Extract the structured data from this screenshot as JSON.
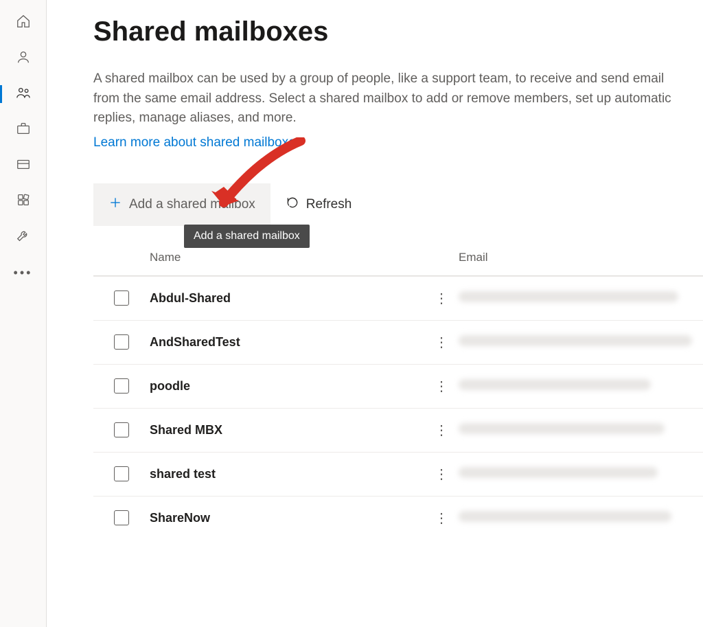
{
  "page": {
    "title": "Shared mailboxes",
    "description": "A shared mailbox can be used by a group of people, like a support team, to receive and send email from the same email address. Select a shared mailbox to add or remove members, set up automatic replies, manage aliases, and more.",
    "learn_link": "Learn more about shared mailboxes"
  },
  "toolbar": {
    "add_label": "Add a shared mailbox",
    "refresh_label": "Refresh",
    "tooltip": "Add a shared mailbox"
  },
  "table": {
    "headers": {
      "name": "Name",
      "email": "Email"
    },
    "rows": [
      {
        "name": "Abdul-Shared"
      },
      {
        "name": "AndSharedTest"
      },
      {
        "name": "poodle"
      },
      {
        "name": "Shared MBX"
      },
      {
        "name": "shared test"
      },
      {
        "name": "ShareNow"
      }
    ]
  },
  "sidebar": {
    "items": [
      "home",
      "user",
      "teams",
      "briefcase",
      "billing",
      "apps",
      "settings",
      "more"
    ]
  },
  "colors": {
    "accent": "#0078d4",
    "arrow": "#d93025"
  }
}
